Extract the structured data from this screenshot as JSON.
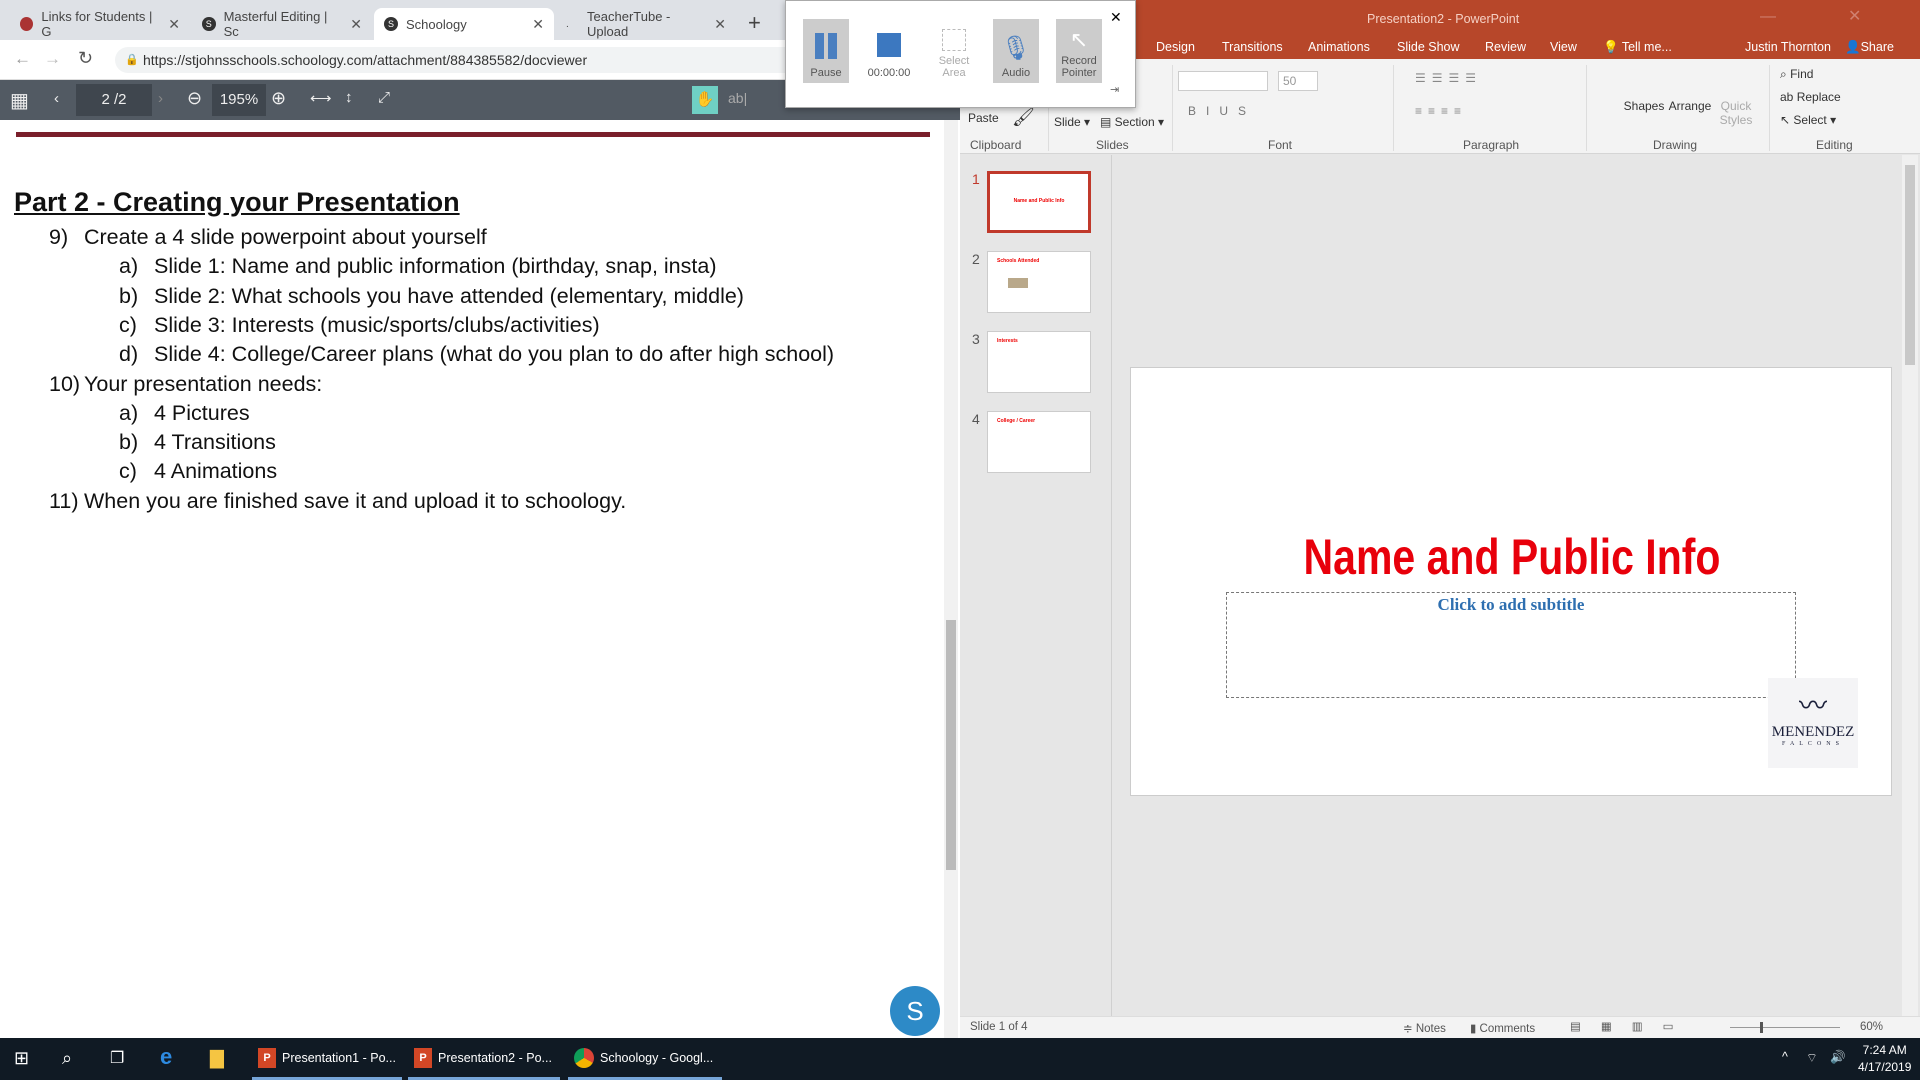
{
  "browser": {
    "tabs": [
      {
        "label": "Links for Students | G",
        "icon": "school-icon"
      },
      {
        "label": "Masterful Editing | Sc",
        "icon": "schoology-icon"
      },
      {
        "label": "Schoology",
        "icon": "schoology-icon",
        "active": true
      },
      {
        "label": "TeacherTube - Upload",
        "icon": "loading-icon"
      }
    ],
    "url": "https://stjohnsschools.schoology.com/attachment/884385582/docviewer",
    "pdf_toolbar": {
      "page_current": "2",
      "page_total": "/2",
      "zoom": "195%"
    }
  },
  "document": {
    "heading": "Part 2 - Creating your Presentation",
    "lines": [
      {
        "marker": "9)",
        "text": "Create a 4 slide powerpoint about yourself",
        "level": 1
      },
      {
        "marker": "a)",
        "text": "Slide 1: Name and public information (birthday, snap, insta)",
        "level": 2
      },
      {
        "marker": "b)",
        "text": "Slide 2: What schools you have attended (elementary, middle)",
        "level": 2
      },
      {
        "marker": "c)",
        "text": "Slide 3: Interests (music/sports/clubs/activities)",
        "level": 2
      },
      {
        "marker": "d)",
        "text": "Slide 4: College/Career plans (what do you plan to do after high school)",
        "level": 2
      },
      {
        "marker": "10)",
        "text": "Your presentation needs:",
        "level": 1
      },
      {
        "marker": "a)",
        "text": "4 Pictures",
        "level": 2
      },
      {
        "marker": "b)",
        "text": "4 Transitions",
        "level": 2
      },
      {
        "marker": "c)",
        "text": "4 Animations",
        "level": 2
      },
      {
        "marker": "11)",
        "text": "When you are finished save it and upload it to schoology.",
        "level": 1
      }
    ],
    "chat_bubble": "S"
  },
  "recorder": {
    "pause": "Pause",
    "timer": "00:00:00",
    "select_area": [
      "Select",
      "Area"
    ],
    "audio": "Audio",
    "record_pointer": [
      "Record",
      "Pointer"
    ]
  },
  "powerpoint": {
    "title": "Presentation2 - PowerPoint",
    "tabs": [
      "Design",
      "Transitions",
      "Animations",
      "Slide Show",
      "Review",
      "View",
      "Tell me..."
    ],
    "user": "Justin Thornton",
    "share": "Share",
    "ribbon": {
      "font_size": "50",
      "groups": [
        "Clipboard",
        "Slides",
        "Font",
        "Paragraph",
        "Drawing",
        "Editing"
      ],
      "paste": "Paste",
      "new_slide": "Slide",
      "section": "Section",
      "shapes": "Shapes",
      "arrange": "Arrange",
      "quick_styles": [
        "Quick",
        "Styles"
      ],
      "find": "Find",
      "replace": "Replace",
      "select": "Select"
    },
    "thumbnails": [
      {
        "num": "1",
        "title": "Name and Public Info"
      },
      {
        "num": "2",
        "title": "Schools Attended"
      },
      {
        "num": "3",
        "title": "Interests"
      },
      {
        "num": "4",
        "title": "College / Career"
      }
    ],
    "slide": {
      "title": "Name and Public Info",
      "subtitle_placeholder": "Click to add subtitle",
      "logo": "MENENDEZ FALCONS"
    },
    "status": {
      "slide": "Slide 1 of 4",
      "notes": "Notes",
      "comments": "Comments",
      "zoom": "60%",
      "zoom_level": 60
    },
    "colors": {
      "brand": "#b7472a",
      "title_red": "#e8000b",
      "subtitle_blue": "#2e6fb0"
    }
  },
  "taskbar": {
    "apps": [
      "Presentation1 - Po...",
      "Presentation2 - Po...",
      "Schoology - Googl..."
    ],
    "time": "7:24 AM",
    "date": "4/17/2019"
  }
}
